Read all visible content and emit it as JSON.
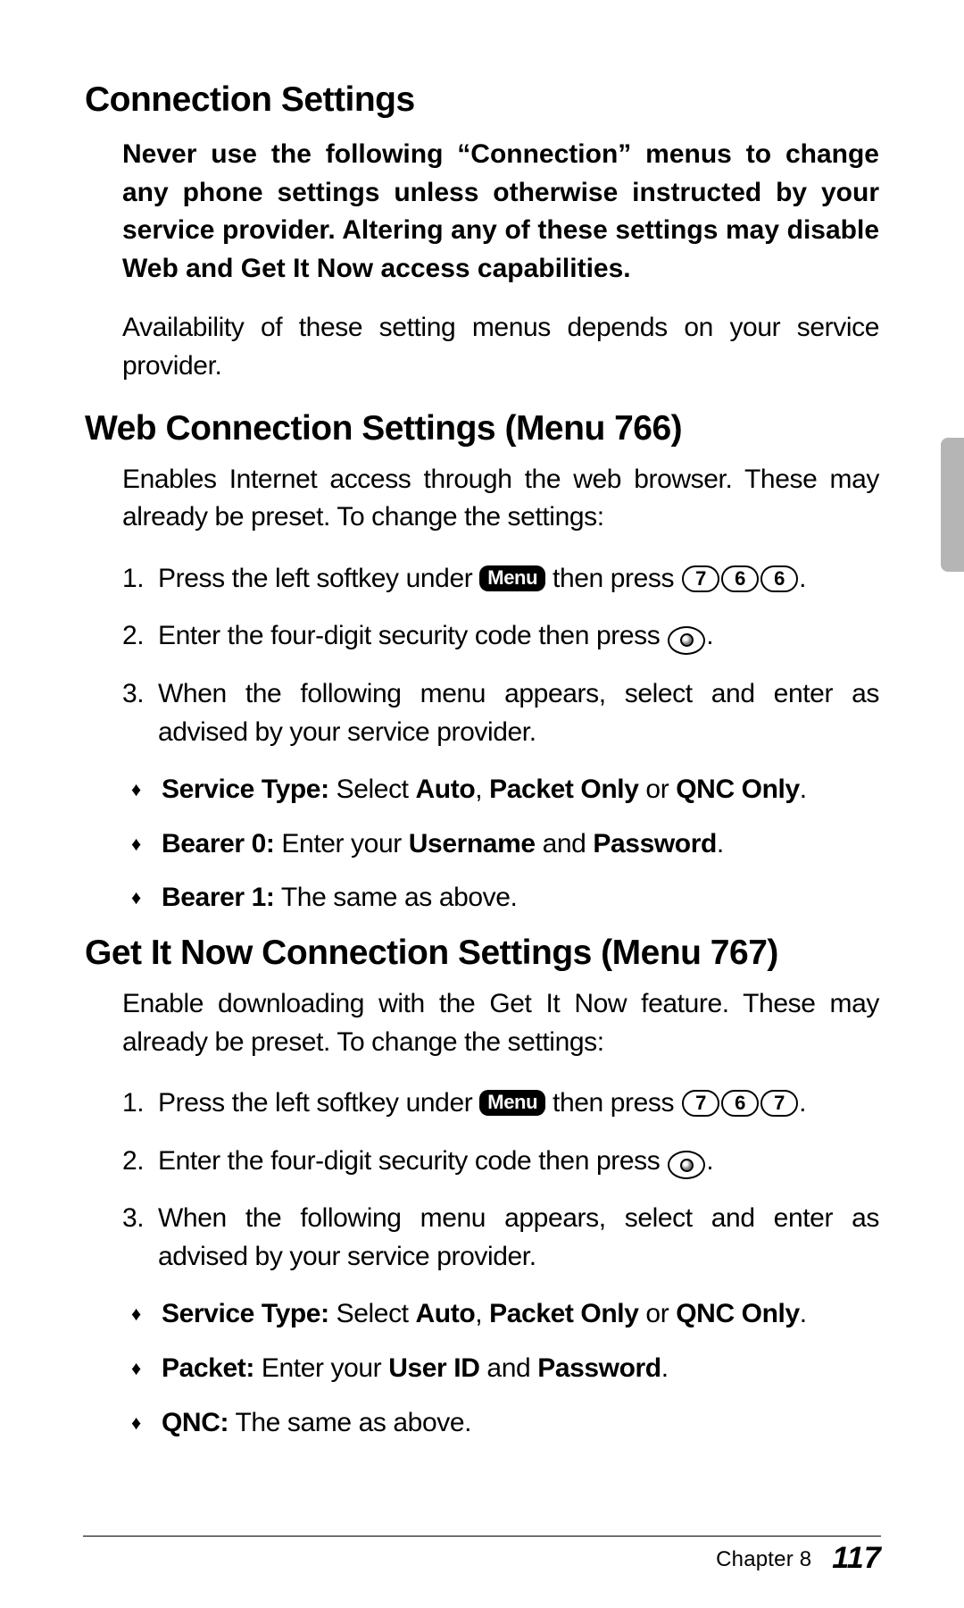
{
  "h1": "Connection Settings",
  "warning": "Never use the following “Connection” menus to change any phone settings unless otherwise instructed by your service provider. Altering any of these settings may disable Web and Get It Now access capabilities.",
  "availability": "Availability of these setting menus depends on your service provider.",
  "web": {
    "title": "Web Connection Settings (Menu 766)",
    "intro": "Enables Internet access through the web browser. These may already be preset. To change the settings:",
    "steps": {
      "s1a": "Press the left softkey under ",
      "s1b": " then press ",
      "keys": [
        "7",
        "6",
        "6"
      ],
      "s2": "Enter the four-digit security code then press ",
      "s3": "When the following menu appears, select and enter as advised by your service provider."
    },
    "bullets": {
      "b1_label": "Service Type:",
      "b1_text1": " Select ",
      "b1_auto": "Auto",
      "b1_comma": ", ",
      "b1_packet": "Packet Only",
      "b1_or": " or ",
      "b1_qnc": "QNC Only",
      "b2_label": "Bearer 0:",
      "b2_text1": " Enter your ",
      "b2_user": "Username",
      "b2_and": " and ",
      "b2_pass": "Password",
      "b3_label": "Bearer 1:",
      "b3_text": " The same as above."
    }
  },
  "gin": {
    "title": "Get It Now Connection Settings (Menu 767)",
    "intro": "Enable downloading with the Get It Now feature. These may already be preset. To change the settings:",
    "steps": {
      "s1a": "Press the left softkey under ",
      "s1b": " then press ",
      "keys": [
        "7",
        "6",
        "7"
      ],
      "s2": "Enter the four-digit security code then press ",
      "s3": "When the following menu appears, select and enter as advised by your service provider."
    },
    "bullets": {
      "b1_label": "Service Type:",
      "b1_text1": " Select ",
      "b1_auto": "Auto",
      "b1_comma": ", ",
      "b1_packet": "Packet Only",
      "b1_or": " or ",
      "b1_qnc": "QNC Only",
      "b2_label": "Packet:",
      "b2_text1": " Enter your ",
      "b2_user": "User ID",
      "b2_and": " and ",
      "b2_pass": "Password",
      "b3_label": "QNC:",
      "b3_text": " The same as above."
    }
  },
  "menu_label": "Menu",
  "period": ".",
  "footer": {
    "chapter": "Chapter 8",
    "page": "117"
  }
}
